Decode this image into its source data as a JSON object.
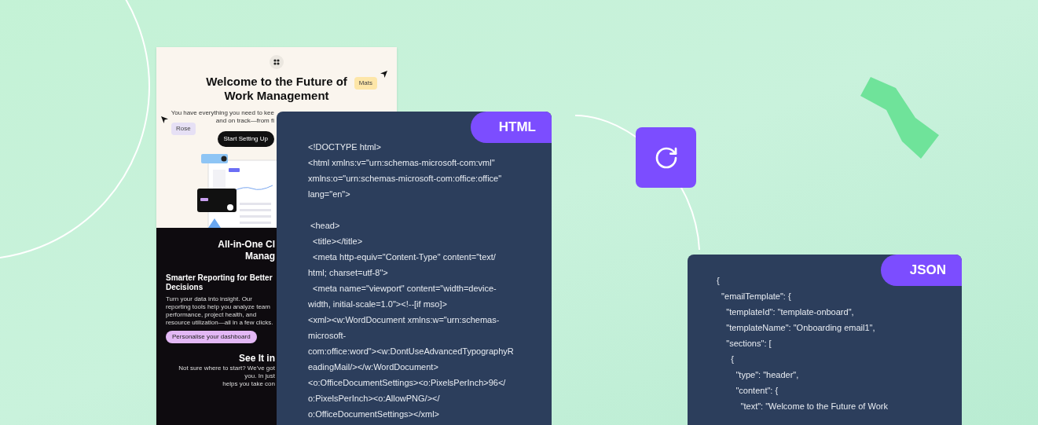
{
  "email_preview": {
    "heading": "Welcome to the Future of Work Management",
    "subtitle_lines": [
      "You have everything you need to kee",
      "and on track—from fi"
    ],
    "cta": "Start Setting Up",
    "cursors": [
      {
        "label": "Mats",
        "color": "#fde6a8"
      },
      {
        "label": "Rose",
        "color": "#e6e0f5"
      }
    ],
    "dark_heading_lines": [
      "All-in-One Cl",
      "Manag"
    ],
    "feature": {
      "title": "Smarter Reporting for Better Decisions",
      "body": "Turn your data into insight. Our reporting tools help you analyze team performance, project health, and resource utilization—all in a few clicks.",
      "button": "Personalise your dashboard"
    },
    "section_title": "See It in",
    "section_lines": [
      "Not sure where to start? We've got you. In just",
      "helps you take con"
    ]
  },
  "html_card": {
    "badge": "HTML",
    "blocks": [
      [
        "<!DOCTYPE html>",
        "<html xmlns:v=\"urn:schemas-microsoft-com:vml\"",
        "xmlns:o=\"urn:schemas-microsoft-com:office:office\"",
        "lang=\"en\">"
      ],
      [
        " <head>",
        "  <title></title>",
        "  <meta http-equiv=\"Content-Type\" content=\"text/",
        "html; charset=utf-8\">",
        "  <meta name=\"viewport\" content=\"width=device-",
        "width, initial-scale=1.0\"><!--[if mso]>",
        "<xml><w:WordDocument xmlns:w=\"urn:schemas-",
        "microsoft-",
        "com:office:word\"><w:DontUseAdvancedTypographyR",
        "eadingMail/></w:WordDocument>",
        "<o:OfficeDocumentSettings><o:PixelsPerInch>96</",
        "o:PixelsPerInch><o:AllowPNG/></",
        "o:OfficeDocumentSettings></xml>"
      ]
    ]
  },
  "json_card": {
    "badge": "JSON",
    "blocks": [
      [
        "{",
        "  \"emailTemplate\": {",
        "    \"templateId\": \"template-onboard\",",
        "    \"templateName\": \"Onboarding email1\",",
        "    \"sections\": [",
        "      {",
        "        \"type\": \"header\",",
        "        \"content\": {",
        "          \"text\": \"Welcome to the Future of Work"
      ]
    ]
  }
}
